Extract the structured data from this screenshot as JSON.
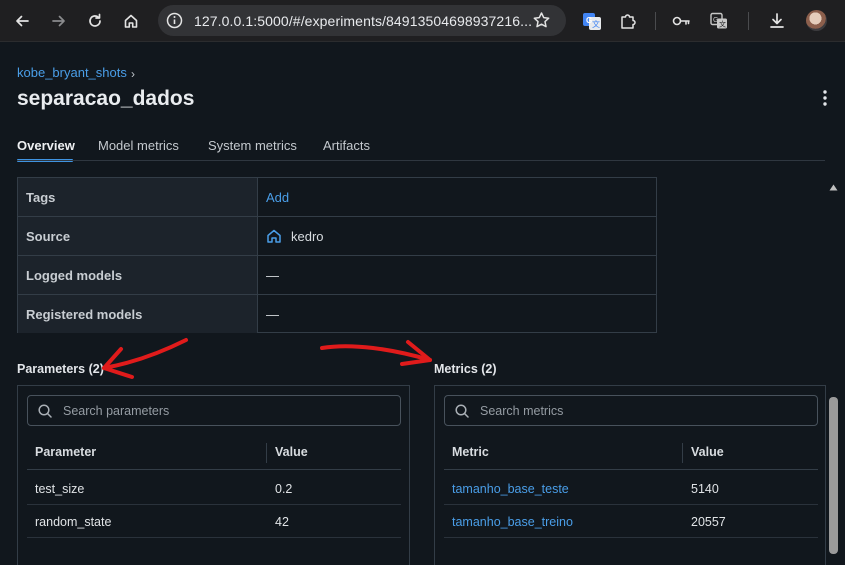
{
  "browser": {
    "url": "127.0.0.1:5000/#/experiments/84913504698937216...",
    "icons": [
      "back-icon",
      "forward-icon",
      "reload-icon",
      "home-icon",
      "site-info-icon",
      "bookmark-star-icon",
      "google-translate-icon",
      "extensions-puzzle-icon",
      "password-key-icon",
      "translate-page-icon",
      "downloads-icon",
      "profile-avatar"
    ]
  },
  "header": {
    "breadcrumb": "kobe_bryant_shots",
    "breadcrumb_separator": "›",
    "title": "separacao_dados"
  },
  "tabs": [
    {
      "label": "Overview",
      "active": true
    },
    {
      "label": "Model metrics",
      "active": false
    },
    {
      "label": "System metrics",
      "active": false
    },
    {
      "label": "Artifacts",
      "active": false
    }
  ],
  "details": {
    "tags_label": "Tags",
    "tags_value": "Add",
    "source_label": "Source",
    "source_value": "kedro",
    "logged_models_label": "Logged models",
    "logged_models_value": "—",
    "registered_models_label": "Registered models",
    "registered_models_value": "—"
  },
  "parameters": {
    "title": "Parameters (2)",
    "search_placeholder": "Search parameters",
    "col_name": "Parameter",
    "col_value": "Value",
    "rows": [
      {
        "name": "test_size",
        "value": "0.2"
      },
      {
        "name": "random_state",
        "value": "42"
      }
    ]
  },
  "metrics": {
    "title": "Metrics (2)",
    "search_placeholder": "Search metrics",
    "col_name": "Metric",
    "col_value": "Value",
    "rows": [
      {
        "name": "tamanho_base_teste",
        "value": "5140"
      },
      {
        "name": "tamanho_base_treino",
        "value": "20557"
      }
    ]
  },
  "colors": {
    "accent": "#3f93e0",
    "link": "#4a9ee8",
    "annotation_arrow": "#e01b1b",
    "background": "#11171d"
  }
}
